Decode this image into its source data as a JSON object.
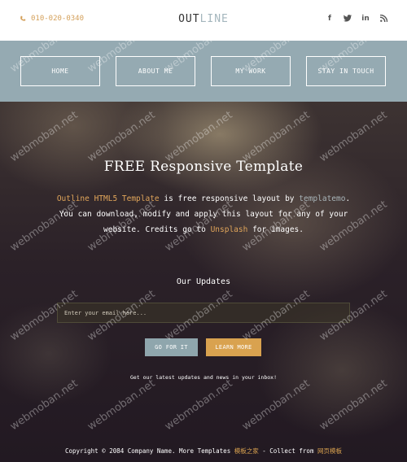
{
  "header": {
    "phone": "010-020-0340",
    "logo_part_a": "OUT",
    "logo_part_b": "LINE",
    "social": [
      "f",
      "t",
      "in",
      "rss"
    ]
  },
  "nav": {
    "items": [
      {
        "label": "HOME"
      },
      {
        "label": "ABOUT ME"
      },
      {
        "label": "MY WORK"
      },
      {
        "label": "STAY IN TOUCH"
      }
    ]
  },
  "hero": {
    "title": "FREE Responsive Template",
    "text_part1": "Outline HTML5 Template",
    "text_part2": " is free responsive layout by ",
    "text_part3": "templatemo",
    "text_part4": ". You can download, modify and apply this layout for any of your website. Credits go to ",
    "text_part5": "Unsplash",
    "text_part6": " for images."
  },
  "updates": {
    "title": "Our Updates",
    "email_placeholder": "Enter your email here...",
    "go_label": "GO FOR IT",
    "more_label": "LEARN MORE",
    "note": "Get our latest updates and news in your inbox!"
  },
  "footer": {
    "text_a": "Copyright © 2084 Company Name. More Templates ",
    "link_a": "模板之家",
    "text_b": " - Collect from ",
    "link_b": "网页模板"
  },
  "watermark": "webmoban.net",
  "colors": {
    "accent": "#d9a24f",
    "nav_bg": "#95aab2",
    "button_grey": "#8fa6ad"
  }
}
